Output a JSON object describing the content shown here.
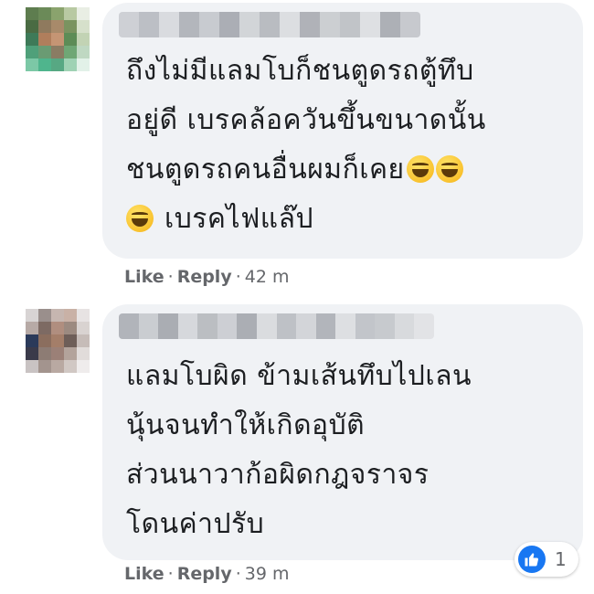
{
  "comments": [
    {
      "lines": [
        "ถึงไม่มีแลมโบก็ชนตูดรถตู้ทึบ",
        "อยู่ดี เบรคล้อควันขึ้นขนาดนั้น",
        "ชนตูดรถคนอื่นผมก็เคย",
        "เบรคไฟแล๊ป"
      ],
      "like_label": "Like",
      "reply_label": "Reply",
      "time": "42 m"
    },
    {
      "lines": [
        "แลมโบผิด ข้ามเส้นทึบไปเลน",
        "นุ้นจนทำให้เกิดอุบัติ",
        "ส่วนนาวาก้อผิดกฎจราจร",
        "โดนค่าปรับ"
      ],
      "like_label": "Like",
      "reply_label": "Reply",
      "time": "39 m",
      "reaction_count": "1"
    }
  ],
  "colors": {
    "bubble": "#f0f2f5",
    "text": "#1c1e21",
    "meta": "#65676b",
    "like_blue": "#1877f2"
  }
}
